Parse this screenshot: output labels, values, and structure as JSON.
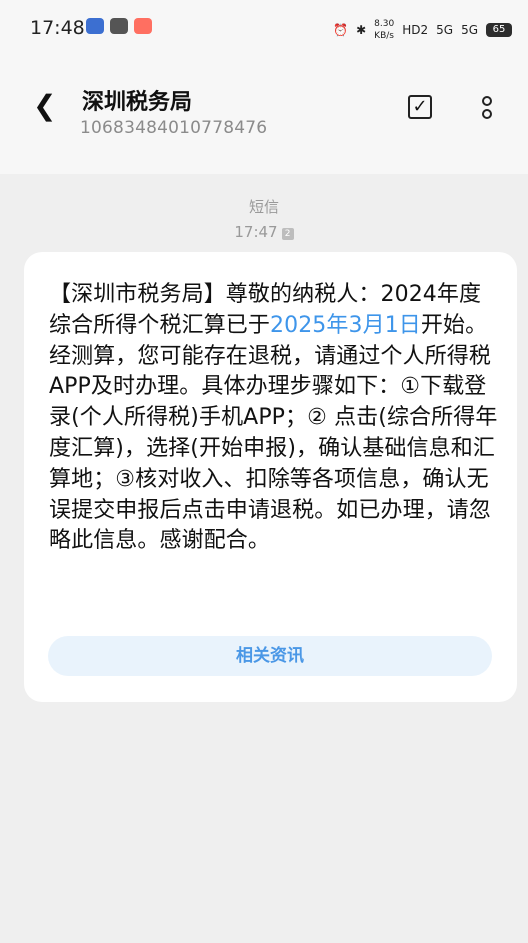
{
  "status_bar": {
    "time": "17:48",
    "net_speed": "8.30\nKB/s",
    "network1": "HD2",
    "network2": "5G",
    "network3": "5G",
    "battery": "65"
  },
  "header": {
    "title": "深圳税务局",
    "number": "10683484010778476"
  },
  "message_meta": {
    "label": "短信",
    "time": "17:47"
  },
  "message": {
    "text_part1": "【深圳市税务局】尊敬的纳税人：2024年度综合所得个税汇算已于",
    "link_text": "2025年3月1日",
    "text_part2": "开始。经测算，您可能存在退税，请通过个人所得税APP及时办理。具体办理步骤如下：①下载登录(个人所得税)手机APP；② 点击(综合所得年度汇算)，选择(开始申报)，确认基础信息和汇算地；③核对收入、扣除等各项信息，确认无误提交申报后点击申请退税。如已办理，请忽略此信息。感谢配合。",
    "related_button": "相关资讯"
  },
  "icons": {
    "back": "arrow-left-icon",
    "check": "checkbox-icon",
    "more": "more-vertical-icon"
  }
}
